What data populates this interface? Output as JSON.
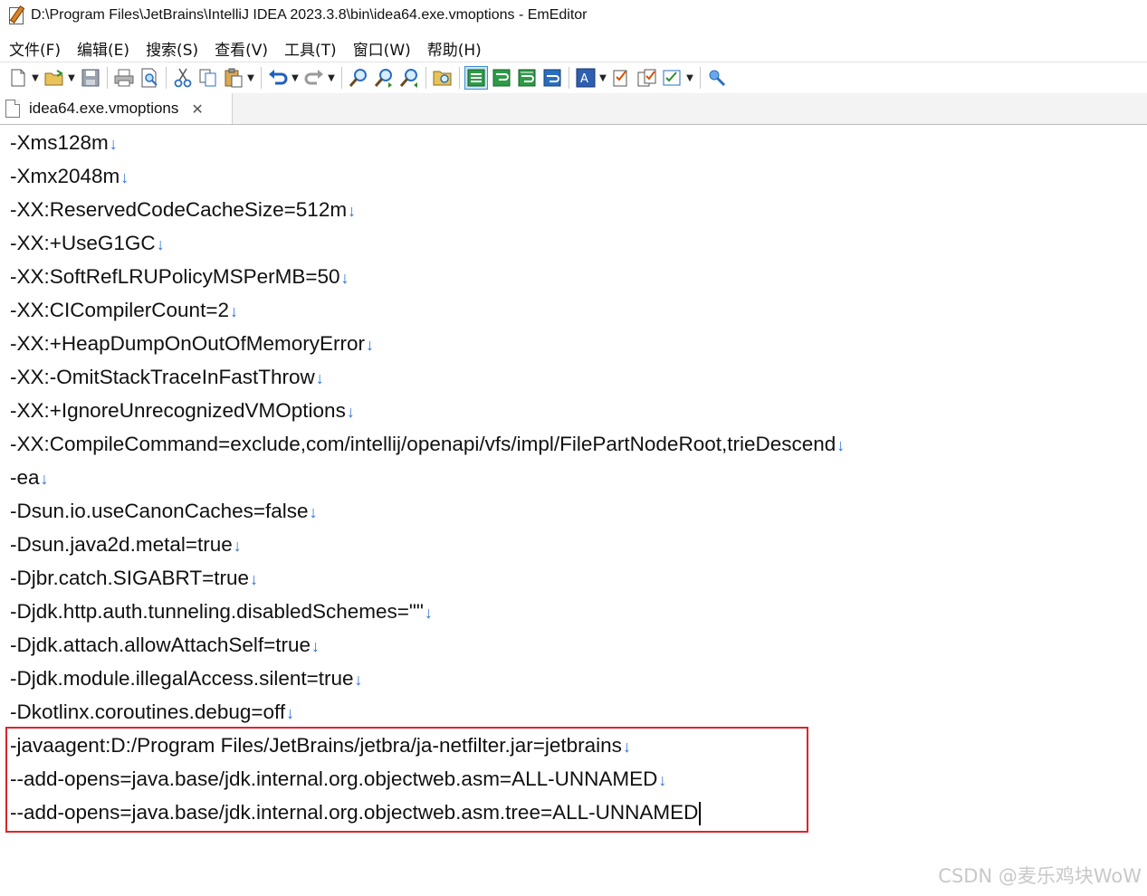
{
  "window": {
    "title": "D:\\Program Files\\JetBrains\\IntelliJ IDEA 2023.3.8\\bin\\idea64.exe.vmoptions - EmEditor"
  },
  "menu": [
    {
      "label": "文件(F)"
    },
    {
      "label": "编辑(E)"
    },
    {
      "label": "搜索(S)"
    },
    {
      "label": "查看(V)"
    },
    {
      "label": "工具(T)"
    },
    {
      "label": "窗口(W)"
    },
    {
      "label": "帮助(H)"
    }
  ],
  "toolbar": {
    "icons": [
      "new-file-icon",
      "open-folder-icon",
      "save-icon",
      "print-icon",
      "print-preview-icon",
      "cut-icon",
      "copy-icon",
      "paste-icon",
      "undo-icon",
      "redo-icon",
      "find-icon",
      "find-next-icon",
      "find-previous-icon",
      "find-in-files-icon",
      "wrap-none-icon",
      "wrap-by-chars-icon",
      "wrap-by-window-icon",
      "wrap-by-page-icon",
      "font-icon",
      "properties-icon",
      "configurations-icon",
      "macro-icon",
      "pin-icon"
    ]
  },
  "tab": {
    "label": "idea64.exe.vmoptions",
    "close": "✕"
  },
  "editor": {
    "eol_mark": "↓",
    "lines": [
      "-Xms128m",
      "-Xmx2048m",
      "-XX:ReservedCodeCacheSize=512m",
      "-XX:+UseG1GC",
      "-XX:SoftRefLRUPolicyMSPerMB=50",
      "-XX:CICompilerCount=2",
      "-XX:+HeapDumpOnOutOfMemoryError",
      "-XX:-OmitStackTraceInFastThrow",
      "-XX:+IgnoreUnrecognizedVMOptions",
      "-XX:CompileCommand=exclude,com/intellij/openapi/vfs/impl/FilePartNodeRoot,trieDescend",
      "-ea",
      "-Dsun.io.useCanonCaches=false",
      "-Dsun.java2d.metal=true",
      "-Djbr.catch.SIGABRT=true",
      "-Djdk.http.auth.tunneling.disabledSchemes=\"\"",
      "-Djdk.attach.allowAttachSelf=true",
      "-Djdk.module.illegalAccess.silent=true",
      "-Dkotlinx.coroutines.debug=off",
      "-javaagent:D:/Program Files/JetBrains/jetbra/ja-netfilter.jar=jetbrains",
      "--add-opens=java.base/jdk.internal.org.objectweb.asm=ALL-UNNAMED",
      "--add-opens=java.base/jdk.internal.org.objectweb.asm.tree=ALL-UNNAMED"
    ]
  },
  "colors": {
    "eol_mark": "#2a70d6",
    "highlight_border": "#d9262c"
  },
  "watermark": "CSDN @麦乐鸡块WoW"
}
